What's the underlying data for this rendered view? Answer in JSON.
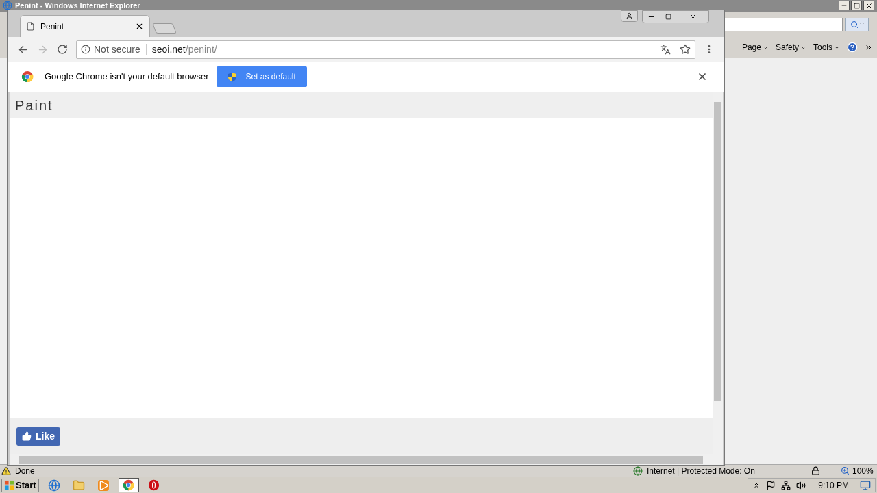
{
  "ie_window": {
    "title": "Penint - Windows Internet Explorer",
    "command_bar": [
      "Page",
      "Safety",
      "Tools"
    ],
    "status_bar": {
      "status": "Done",
      "zone": "Internet | Protected Mode: On",
      "zoom": "100%"
    }
  },
  "chrome": {
    "tab": {
      "title": "Penint"
    },
    "address": {
      "security": "Not secure",
      "host": "seoi.net",
      "path": "/penint/"
    },
    "infobar": {
      "message": "Google Chrome isn't your default browser",
      "button": "Set as default"
    },
    "page": {
      "heading": "Paint",
      "like_button": "Like"
    }
  },
  "taskbar": {
    "start": "Start",
    "apps": [
      {
        "kind": "ie",
        "selected": false
      },
      {
        "kind": "folder",
        "selected": false
      },
      {
        "kind": "media",
        "selected": false
      },
      {
        "kind": "chrome",
        "selected": true
      },
      {
        "kind": "opera",
        "selected": false
      }
    ],
    "clock": "9:10 PM"
  }
}
